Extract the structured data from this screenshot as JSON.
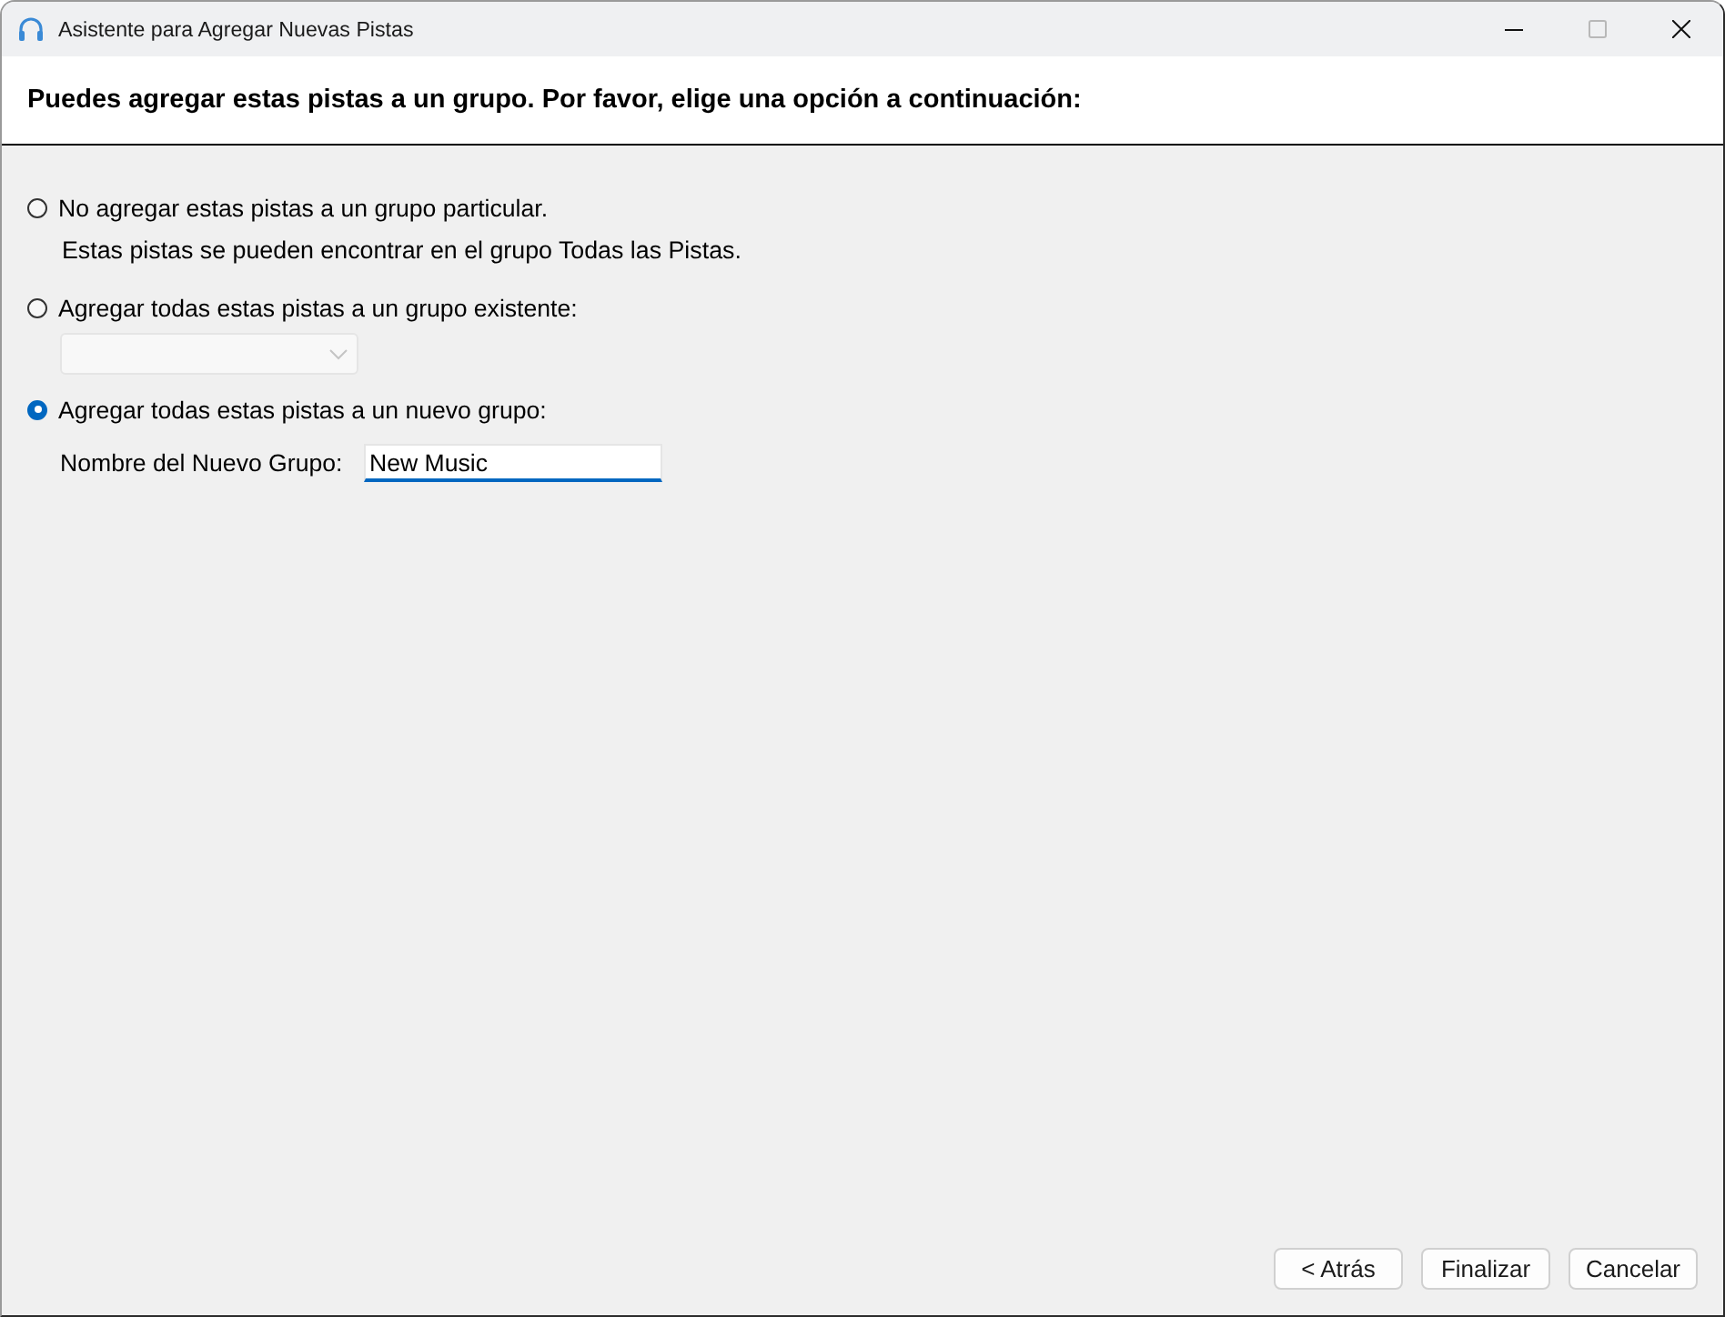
{
  "window": {
    "title": "Asistente para Agregar Nuevas Pistas",
    "controls": [
      {
        "kind": "minimize",
        "disabled": false
      },
      {
        "kind": "maximize",
        "disabled": true
      },
      {
        "kind": "close",
        "disabled": false
      }
    ]
  },
  "header": {
    "instruction": "Puedes agregar estas pistas a un grupo. Por favor, elige una opción a continuación:"
  },
  "options": [
    {
      "kind": "note",
      "label": "No agregar estas pistas a un grupo particular.",
      "selected": false,
      "note": "Estas pistas se pueden encontrar en el grupo Todas las Pistas."
    },
    {
      "kind": "dropdown",
      "label": "Agregar todas estas pistas a un grupo existente:",
      "selected": false,
      "dropdown": {
        "disabled": true
      }
    },
    {
      "kind": "text_field",
      "label": "Agregar todas estas pistas a un nuevo grupo:",
      "selected": true,
      "field": {
        "label": "Nombre del Nuevo Grupo:",
        "value": "New Music",
        "focused": true
      }
    }
  ],
  "buttons": [
    {
      "label": "< Atrás"
    },
    {
      "label": "Finalizar"
    },
    {
      "label": "Cancelar"
    }
  ]
}
